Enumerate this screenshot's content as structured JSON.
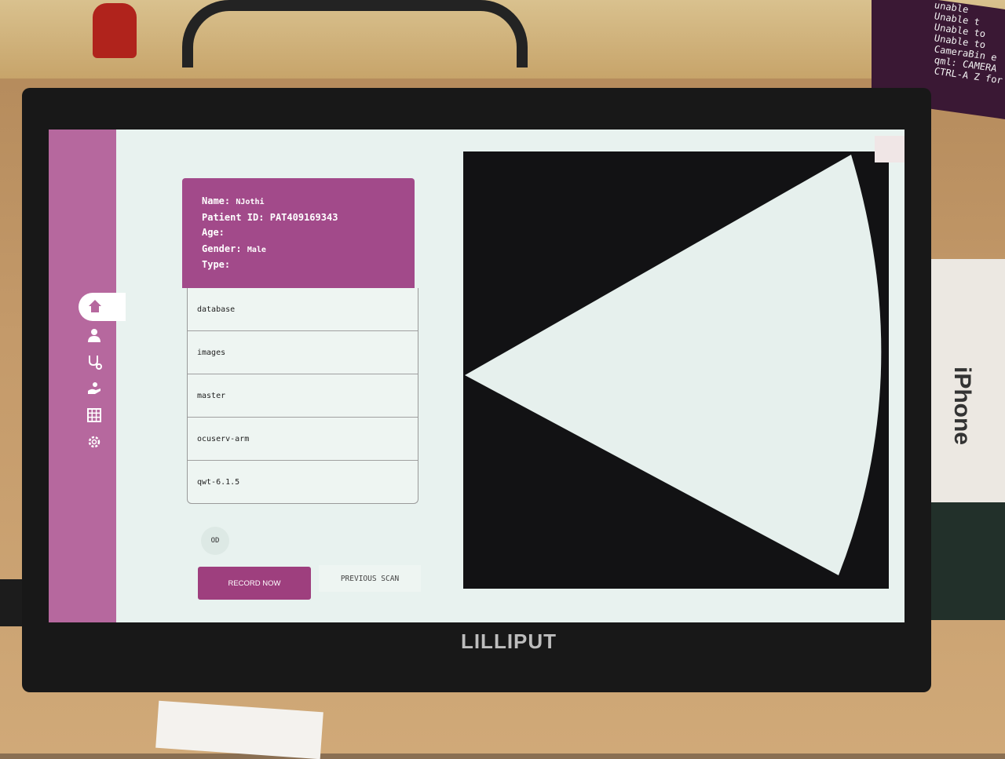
{
  "screen_title": "",
  "patient": {
    "name_label": "Name:",
    "name_value": "NJothi",
    "id_label": "Patient ID:",
    "id_value": "PAT409169343",
    "age_label": "Age:",
    "age_value": "",
    "gender_label": "Gender:",
    "gender_value": "Male",
    "type_label": "Type:",
    "type_value": ""
  },
  "folders": [
    "database",
    "images",
    "master",
    "ocuserv-arm",
    "qwt-6.1.5"
  ],
  "eye_toggle": "OD",
  "actions": {
    "record_label": "RECORD NOW",
    "previous_label": "PREVIOUS SCAN"
  },
  "sidebar": {
    "icons": [
      "home-icon",
      "doctor-icon",
      "stethoscope-icon",
      "hand-icon",
      "grid-icon",
      "gear-icon"
    ],
    "active": "home-icon"
  },
  "monitor_brand": "LILLIPUT",
  "background_terminal": [
    "unable",
    "Unable t",
    "Unable to",
    "Unable to",
    "CameraBin e",
    "qml: CAMERA",
    "CTRL-A Z for h"
  ],
  "background_box_label": "iPhone",
  "colors": {
    "sidebar": "#b6689e",
    "header": "#a24a8a",
    "record_button": "#9e3f7e",
    "screen_bg": "#e8f2ef",
    "scan_bg": "#121214"
  }
}
